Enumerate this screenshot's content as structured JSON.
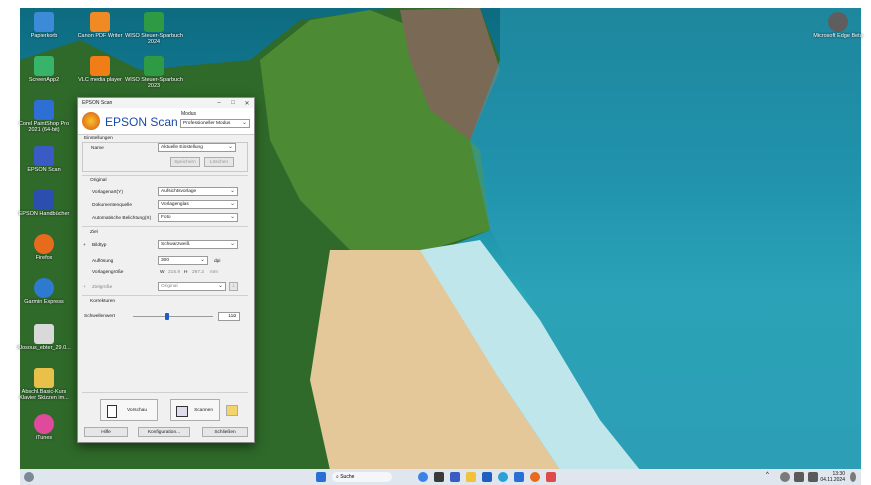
{
  "desktop_icons": [
    {
      "label": "Papierkorb",
      "icon": "recycle-bin-icon",
      "color": "#3b8bd8"
    },
    {
      "label": "Canon PDF Writer",
      "icon": "canon-pdf-icon",
      "color": "#f08a24"
    },
    {
      "label": "WISO Steuer-Sparbuch 2024",
      "icon": "wiso-icon",
      "color": "#2f9a44"
    },
    {
      "label": "ScreenApp2",
      "icon": "screen-app-icon",
      "color": "#38b46a"
    },
    {
      "label": "VLC media player",
      "icon": "vlc-cone-icon",
      "color": "#f07d16"
    },
    {
      "label": "WISO Steuer-Sparbuch 2023",
      "icon": "wiso-icon",
      "color": "#2f9a44"
    },
    {
      "label": "Corel PaintShop Pro 2021 (64-bit)",
      "icon": "paintshop-icon",
      "color": "#2e6fd6"
    },
    {
      "label": "EPSON Scan",
      "icon": "epson-scan-icon",
      "color": "#3a5bc4"
    },
    {
      "label": "EPSON Handbücher",
      "icon": "epson-manual-icon",
      "color": "#2a4fb0"
    },
    {
      "label": "Firefox",
      "icon": "firefox-icon",
      "color": "#e86a1c"
    },
    {
      "label": "Garmin Express",
      "icon": "garmin-icon",
      "color": "#2f7ad1"
    },
    {
      "label": "Klosous_ebter_29.0...",
      "icon": "document-icon",
      "color": "#d9d9d9"
    },
    {
      "label": "Abschl.Basic-Kurs Klavier Skizzen im...",
      "icon": "folder-doc-icon",
      "color": "#e9c04a"
    },
    {
      "label": "iTunes",
      "icon": "itunes-icon",
      "color": "#e04a9c"
    },
    {
      "label": "Microsoft Edge Beta",
      "icon": "edge-icon",
      "color": "#5e5e5e"
    }
  ],
  "epson": {
    "window_title": "EPSON Scan",
    "brand": "EPSON Scan",
    "modus_label": "Modus",
    "modus_value": "Professioneller Modus",
    "settings_header": "Einstellungen",
    "name_label": "Name",
    "name_value": "Aktuelle Einstellung",
    "save_button": "Speichern",
    "delete_button": "Löschen",
    "original_header": "Original",
    "vorlagenart_label": "Vorlagenart(Y)",
    "vorlagenart_value": "Aufsichtsvorlage",
    "dokumentenquelle_label": "Dokumentenquelle",
    "dokumentenquelle_value": "Vorlagenglas",
    "belichtung_label": "Automatische Belichtung(X)",
    "belichtung_value": "Foto",
    "ziel_header": "Ziel",
    "bildtyp_label": "Bildtyp",
    "bildtyp_value": "Schwarzweiß",
    "aufloesung_label": "Auflösung",
    "aufloesung_value": "300",
    "aufloesung_unit": "dpi",
    "vorlagengroesse_label": "Vorlagengröße",
    "w_label": "W",
    "w_value": "215.9",
    "h_label": "H",
    "h_value": "297.2",
    "size_unit": "mm",
    "zielgroesse_label": "Zielgröße",
    "zielgroesse_value": "Original",
    "korrekturen_header": "Korrekturen",
    "schwellenwert_label": "Schwellenwert",
    "schwellenwert_value": "110",
    "schwellenwert_fraction": 0.43,
    "preview_button": "Vorschau",
    "scan_button": "Scannen",
    "help_button": "Hilfe",
    "config_button": "Konfiguration...",
    "close_button": "Schließen"
  },
  "taskbar": {
    "search_placeholder": "Suche",
    "time": "13:30",
    "date": "04.11.2024"
  },
  "colors": {
    "epson_blue": "#1a4aa8",
    "taskbar": "#dfe6ee"
  }
}
